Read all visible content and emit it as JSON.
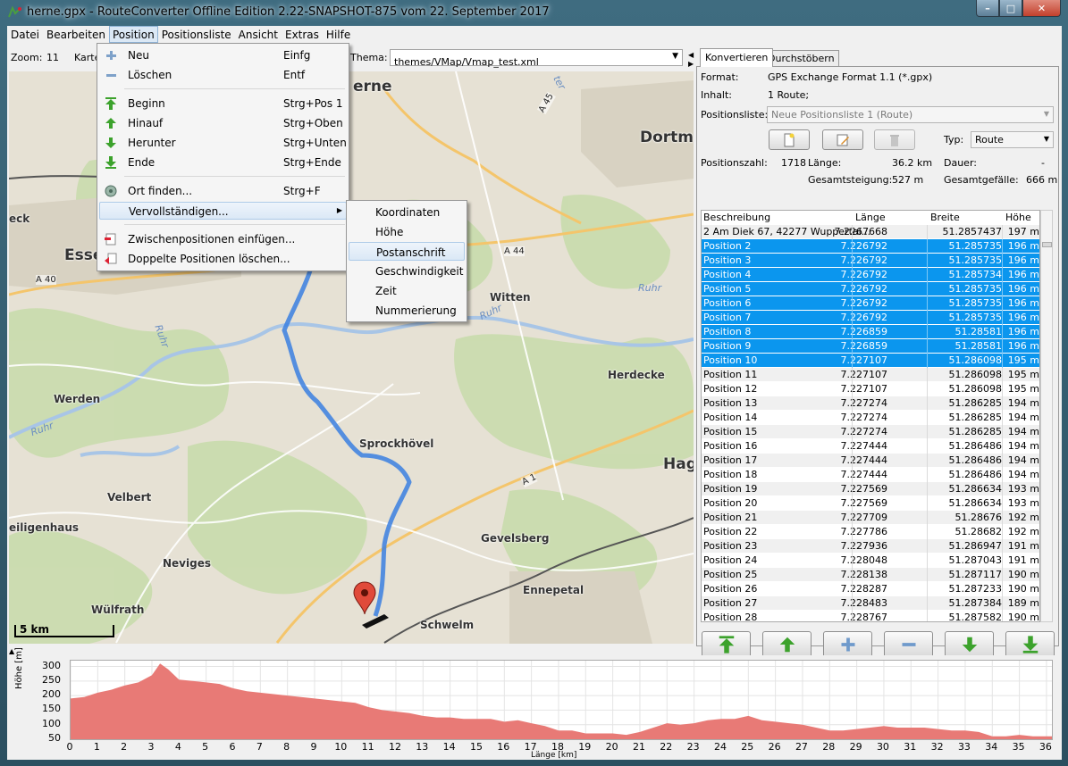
{
  "window": {
    "title": "herne.gpx - RouteConverter Offline Edition 2.22-SNAPSHOT-875 vom 22. September 2017",
    "minimize_glyph": "–",
    "maximize_glyph": "□",
    "close_glyph": "✕"
  },
  "menubar": [
    "Datei",
    "Bearbeiten",
    "Position",
    "Positionsliste",
    "Ansicht",
    "Extras",
    "Hilfe"
  ],
  "map_toolbar": {
    "zoom_label": "Zoom:",
    "zoom_value": "11",
    "map_label": "Karte",
    "theme_label": "Thema:",
    "theme_value": "themes/VMap/Vmap_test.xml"
  },
  "map": {
    "scale_label": "5 km",
    "places": {
      "herne": "erne",
      "dortmund": "Dortm",
      "essen": "Esse",
      "eck": "eck",
      "witten": "Witten",
      "werden": "Werden",
      "herdecke": "Herdecke",
      "sprockhoevel": "Sprockhövel",
      "hagen": "Hag",
      "velbert": "Velbert",
      "heiligenhaus": "eiligenhaus",
      "gevelsberg": "Gevelsberg",
      "neviges": "Neviges",
      "ennepetal": "Ennepetal",
      "wuelfrath": "Wülfrath",
      "schwelm": "Schwelm"
    },
    "roads": {
      "a45": "A 45",
      "a44": "A 44",
      "a40": "A 40",
      "a1": "A 1"
    },
    "rivers": {
      "ruhr1": "Ruhr",
      "ruhr2": "Ruhr",
      "ruhr3": "Ruhr",
      "ruhr4": "Ruhr",
      "ter": "ter"
    }
  },
  "position_menu": [
    {
      "label": "Neu",
      "accel": "Einfg",
      "icon": "plus-icon"
    },
    {
      "label": "Löschen",
      "accel": "Entf",
      "icon": "minus-icon"
    },
    {
      "label": "Beginn",
      "accel": "Strg+Pos 1",
      "icon": "move-top-icon"
    },
    {
      "label": "Hinauf",
      "accel": "Strg+Oben",
      "icon": "move-up-icon"
    },
    {
      "label": "Herunter",
      "accel": "Strg+Unten",
      "icon": "move-down-icon"
    },
    {
      "label": "Ende",
      "accel": "Strg+Ende",
      "icon": "move-bottom-icon"
    },
    {
      "label": "Ort finden...",
      "accel": "Strg+F",
      "icon": "find-place-icon"
    },
    {
      "label": "Vervollständigen...",
      "accel": "",
      "icon": ""
    },
    {
      "label": "Zwischenpositionen einfügen...",
      "accel": "",
      "icon": "insert-positions-icon"
    },
    {
      "label": "Doppelte Positionen löschen...",
      "accel": "",
      "icon": "delete-duplicates-icon"
    }
  ],
  "complete_submenu": [
    "Koordinaten",
    "Höhe",
    "Postanschrift",
    "Geschwindigkeit",
    "Zeit",
    "Nummerierung"
  ],
  "panel": {
    "tabs": [
      "Konvertieren",
      "Durchstöbern"
    ],
    "format_label": "Format:",
    "format_value": "GPS Exchange Format 1.1 (*.gpx)",
    "content_label": "Inhalt:",
    "content_value": "1 Route;",
    "poslist_label": "Positionsliste:",
    "poslist_value": "Neue Positionsliste 1 (Route)",
    "type_label": "Typ:",
    "type_value": "Route",
    "count_label": "Positionszahl:",
    "count_value": "1718",
    "length_label": "Länge:",
    "length_value": "36.2 km",
    "duration_label": "Dauer:",
    "duration_value": "-",
    "ascent_label": "Gesamtsteigung:",
    "ascent_value": "527 m",
    "descent_label": "Gesamtgefälle:",
    "descent_value": "666 m"
  },
  "table": {
    "headers": [
      "Beschreibung",
      "Länge",
      "Breite",
      "Höhe"
    ],
    "rows": [
      {
        "d": "2 Am Diek 67, 42277 Wuppertal...",
        "lon": "7.2267668",
        "lat": "51.2857437",
        "h": "197 m",
        "sel": false
      },
      {
        "d": "Position 2",
        "lon": "7.226792",
        "lat": "51.285735",
        "h": "196 m",
        "sel": true
      },
      {
        "d": "Position 3",
        "lon": "7.226792",
        "lat": "51.285735",
        "h": "196 m",
        "sel": true
      },
      {
        "d": "Position 4",
        "lon": "7.226792",
        "lat": "51.285734",
        "h": "196 m",
        "sel": true
      },
      {
        "d": "Position 5",
        "lon": "7.226792",
        "lat": "51.285735",
        "h": "196 m",
        "sel": true
      },
      {
        "d": "Position 6",
        "lon": "7.226792",
        "lat": "51.285735",
        "h": "196 m",
        "sel": true
      },
      {
        "d": "Position 7",
        "lon": "7.226792",
        "lat": "51.285735",
        "h": "196 m",
        "sel": true
      },
      {
        "d": "Position 8",
        "lon": "7.226859",
        "lat": "51.28581",
        "h": "196 m",
        "sel": true
      },
      {
        "d": "Position 9",
        "lon": "7.226859",
        "lat": "51.28581",
        "h": "196 m",
        "sel": true
      },
      {
        "d": "Position 10",
        "lon": "7.227107",
        "lat": "51.286098",
        "h": "195 m",
        "sel": true
      },
      {
        "d": "Position 11",
        "lon": "7.227107",
        "lat": "51.286098",
        "h": "195 m",
        "sel": false
      },
      {
        "d": "Position 12",
        "lon": "7.227107",
        "lat": "51.286098",
        "h": "195 m",
        "sel": false
      },
      {
        "d": "Position 13",
        "lon": "7.227274",
        "lat": "51.286285",
        "h": "194 m",
        "sel": false
      },
      {
        "d": "Position 14",
        "lon": "7.227274",
        "lat": "51.286285",
        "h": "194 m",
        "sel": false
      },
      {
        "d": "Position 15",
        "lon": "7.227274",
        "lat": "51.286285",
        "h": "194 m",
        "sel": false
      },
      {
        "d": "Position 16",
        "lon": "7.227444",
        "lat": "51.286486",
        "h": "194 m",
        "sel": false
      },
      {
        "d": "Position 17",
        "lon": "7.227444",
        "lat": "51.286486",
        "h": "194 m",
        "sel": false
      },
      {
        "d": "Position 18",
        "lon": "7.227444",
        "lat": "51.286486",
        "h": "194 m",
        "sel": false
      },
      {
        "d": "Position 19",
        "lon": "7.227569",
        "lat": "51.286634",
        "h": "193 m",
        "sel": false
      },
      {
        "d": "Position 20",
        "lon": "7.227569",
        "lat": "51.286634",
        "h": "193 m",
        "sel": false
      },
      {
        "d": "Position 21",
        "lon": "7.227709",
        "lat": "51.28676",
        "h": "192 m",
        "sel": false
      },
      {
        "d": "Position 22",
        "lon": "7.227786",
        "lat": "51.28682",
        "h": "192 m",
        "sel": false
      },
      {
        "d": "Position 23",
        "lon": "7.227936",
        "lat": "51.286947",
        "h": "191 m",
        "sel": false
      },
      {
        "d": "Position 24",
        "lon": "7.228048",
        "lat": "51.287043",
        "h": "191 m",
        "sel": false
      },
      {
        "d": "Position 25",
        "lon": "7.228138",
        "lat": "51.287117",
        "h": "190 m",
        "sel": false
      },
      {
        "d": "Position 26",
        "lon": "7.228287",
        "lat": "51.287233",
        "h": "190 m",
        "sel": false
      },
      {
        "d": "Position 27",
        "lon": "7.228483",
        "lat": "51.287384",
        "h": "189 m",
        "sel": false
      },
      {
        "d": "Position 28",
        "lon": "7.228767",
        "lat": "51.287582",
        "h": "190 m",
        "sel": false
      }
    ]
  },
  "chart_data": {
    "type": "area",
    "xlabel": "Länge [km]",
    "ylabel": "Höhe [m]",
    "xlim": [
      0,
      36.2
    ],
    "ylim": [
      50,
      320
    ],
    "xticks": [
      0,
      1,
      2,
      3,
      4,
      5,
      6,
      7,
      8,
      9,
      10,
      11,
      12,
      13,
      14,
      15,
      16,
      17,
      18,
      19,
      20,
      21,
      22,
      23,
      24,
      25,
      26,
      27,
      28,
      29,
      30,
      31,
      32,
      33,
      34,
      35,
      36
    ],
    "yticks": [
      50,
      100,
      150,
      200,
      250,
      300
    ],
    "series": [
      {
        "color": "#e87a76",
        "x": [
          0,
          0.5,
          1,
          1.5,
          2,
          2.5,
          3,
          3.3,
          3.6,
          4,
          4.5,
          5,
          5.5,
          6,
          6.5,
          7,
          7.5,
          8,
          8.5,
          9,
          9.5,
          10,
          10.5,
          11,
          11.5,
          12,
          12.5,
          13,
          13.5,
          14,
          14.5,
          15,
          15.5,
          16,
          16.5,
          17,
          17.5,
          18,
          18.5,
          19,
          19.5,
          20,
          20.5,
          21,
          21.5,
          22,
          22.5,
          23,
          23.5,
          24,
          24.5,
          25,
          25.5,
          26,
          26.5,
          27,
          27.5,
          28,
          28.5,
          29,
          29.5,
          30,
          30.5,
          31,
          31.5,
          32,
          32.5,
          33,
          33.5,
          34,
          34.5,
          35,
          35.5,
          36,
          36.2
        ],
        "y": [
          190,
          195,
          210,
          220,
          235,
          245,
          270,
          310,
          290,
          255,
          250,
          245,
          240,
          225,
          215,
          210,
          205,
          200,
          195,
          190,
          185,
          180,
          175,
          160,
          150,
          145,
          140,
          130,
          125,
          125,
          120,
          120,
          120,
          110,
          115,
          105,
          95,
          80,
          80,
          70,
          70,
          70,
          65,
          75,
          90,
          105,
          100,
          105,
          115,
          120,
          120,
          130,
          115,
          110,
          105,
          100,
          90,
          80,
          80,
          85,
          90,
          95,
          90,
          90,
          90,
          85,
          80,
          80,
          75,
          60,
          60,
          65,
          60,
          60,
          60
        ]
      }
    ]
  }
}
